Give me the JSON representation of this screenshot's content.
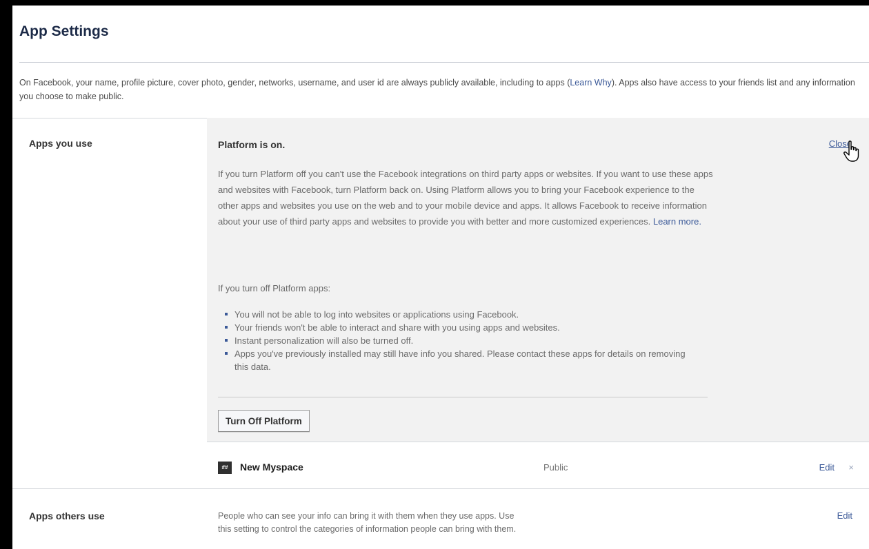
{
  "header": {
    "title": "App Settings"
  },
  "intro": {
    "text": "On Facebook, your name, profile picture, cover photo, gender, networks, username, and user id are always publicly available, including to apps (",
    "learn_why": "Learn Why",
    "text_after": "). Apps also have access to your friends list and any information you choose to make public."
  },
  "sections": {
    "apps_you_use": {
      "label": "Apps you use"
    },
    "apps_others_use": {
      "label": "Apps others use",
      "description": "People who can see your info can bring it with them when they use apps. Use this setting to control the categories of information people can bring with them.",
      "edit_label": "Edit"
    }
  },
  "platform_panel": {
    "title": "Platform is on.",
    "close_label": "Close",
    "body": "If you turn Platform off you can't use the Facebook integrations on third party apps or websites. If you want to use these apps and websites with Facebook, turn Platform back on. Using Platform allows you to bring your Facebook experience to the other apps and websites you use on the web and to your mobile device and apps. It allows Facebook to receive information about your use of third party apps and websites to provide you with better and more customized experiences. ",
    "learn_more": "Learn more.",
    "sub_heading": "If you turn off Platform apps:",
    "bullets": [
      "You will not be able to log into websites or applications using Facebook.",
      "Your friends won't be able to interact and share with you using apps and websites.",
      "Instant personalization will also be turned off.",
      "Apps you've previously installed may still have info you shared. Please contact these apps for details on removing this data."
    ],
    "turn_off_label": "Turn Off Platform"
  },
  "apps": [
    {
      "name": "New Myspace",
      "icon_text": "##",
      "privacy": "Public",
      "edit_label": "Edit",
      "remove_symbol": "×"
    }
  ],
  "icons": {
    "cursor": "hand-pointer-icon",
    "app": "myspace-logo-icon",
    "remove": "close-icon",
    "bullet": "square-bullet-icon"
  },
  "colors": {
    "link": "#3b5998",
    "panel_bg": "#f2f2f2",
    "title": "#1c2a47",
    "body_text": "#6b6b6b"
  }
}
